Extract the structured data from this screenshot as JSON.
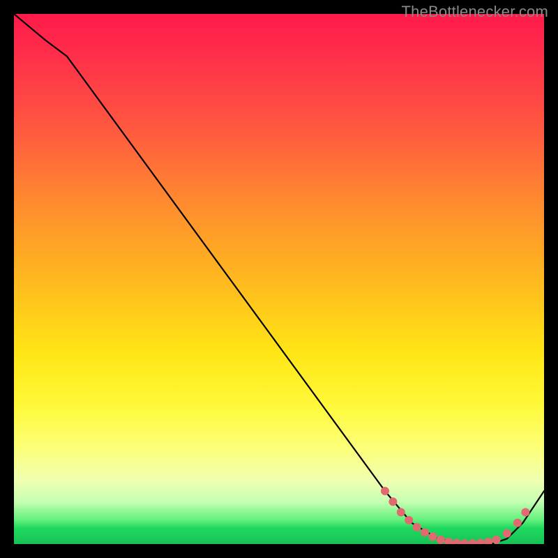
{
  "watermark": {
    "text": "TheBottlenecker.com"
  },
  "chart_data": {
    "type": "line",
    "title": "",
    "xlabel": "",
    "ylabel": "",
    "xlim": [
      0,
      100
    ],
    "ylim": [
      0,
      100
    ],
    "grid": false,
    "legend": false,
    "series": [
      {
        "name": "curve",
        "x": [
          0,
          6,
          10,
          70,
          75,
          80,
          85,
          90,
          93,
          96,
          100
        ],
        "y": [
          100,
          95,
          92,
          10,
          4,
          1,
          0,
          0,
          1,
          4,
          10
        ]
      }
    ],
    "markers": {
      "name": "dots",
      "color": "#e06a6f",
      "radius": 6,
      "points": [
        {
          "x": 70.0,
          "y": 10.0
        },
        {
          "x": 71.5,
          "y": 8.0
        },
        {
          "x": 73.0,
          "y": 6.0
        },
        {
          "x": 74.5,
          "y": 4.5
        },
        {
          "x": 76.0,
          "y": 3.2
        },
        {
          "x": 77.5,
          "y": 2.2
        },
        {
          "x": 79.0,
          "y": 1.4
        },
        {
          "x": 80.5,
          "y": 0.8
        },
        {
          "x": 82.0,
          "y": 0.4
        },
        {
          "x": 83.5,
          "y": 0.2
        },
        {
          "x": 85.0,
          "y": 0.1
        },
        {
          "x": 86.5,
          "y": 0.1
        },
        {
          "x": 88.0,
          "y": 0.2
        },
        {
          "x": 89.5,
          "y": 0.4
        },
        {
          "x": 91.0,
          "y": 0.8
        },
        {
          "x": 93.0,
          "y": 2.0
        },
        {
          "x": 95.0,
          "y": 4.0
        },
        {
          "x": 96.5,
          "y": 6.0
        }
      ]
    },
    "background_gradient": {
      "direction": "vertical",
      "stops": [
        {
          "pos": 0.0,
          "color": "#ff1a4a"
        },
        {
          "pos": 0.22,
          "color": "#ff5a3f"
        },
        {
          "pos": 0.5,
          "color": "#ffb81f"
        },
        {
          "pos": 0.74,
          "color": "#fff93a"
        },
        {
          "pos": 0.92,
          "color": "#c6ffb2"
        },
        {
          "pos": 0.97,
          "color": "#1fd95f"
        },
        {
          "pos": 1.0,
          "color": "#18c255"
        }
      ]
    }
  }
}
